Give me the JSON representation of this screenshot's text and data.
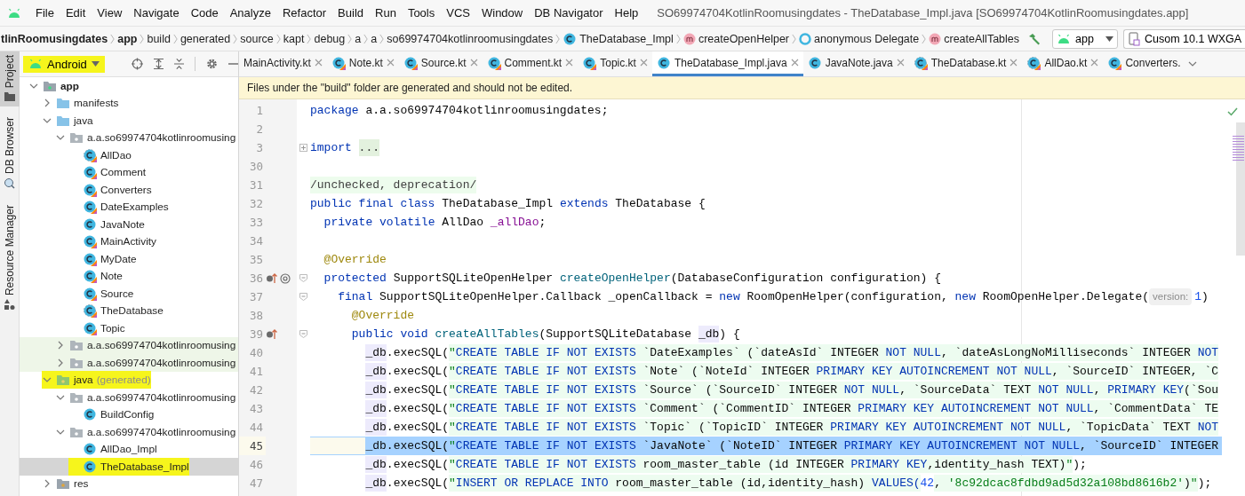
{
  "menu_bar": {
    "items": [
      "File",
      "Edit",
      "View",
      "Navigate",
      "Code",
      "Analyze",
      "Refactor",
      "Build",
      "Run",
      "Tools",
      "VCS",
      "Window",
      "DB Navigator",
      "Help"
    ],
    "title": "SO69974704KotlinRoomusingdates - TheDatabase_Impl.java [SO69974704KotlinRoomusingdates.app]"
  },
  "breadcrumbs": [
    {
      "label": "tlinRoomusingdates",
      "kind": "project"
    },
    {
      "label": "app",
      "kind": "module"
    },
    {
      "label": "build",
      "kind": "folder"
    },
    {
      "label": "generated",
      "kind": "folder"
    },
    {
      "label": "source",
      "kind": "folder"
    },
    {
      "label": "kapt",
      "kind": "folder"
    },
    {
      "label": "debug",
      "kind": "folder"
    },
    {
      "label": "a",
      "kind": "folder"
    },
    {
      "label": "a",
      "kind": "folder"
    },
    {
      "label": "so69974704kotlinroomusingdates",
      "kind": "folder"
    },
    {
      "label": "TheDatabase_Impl",
      "kind": "class"
    },
    {
      "label": "createOpenHelper",
      "kind": "method"
    },
    {
      "label": "anonymous Delegate",
      "kind": "anonymous"
    },
    {
      "label": "createAllTables",
      "kind": "method"
    }
  ],
  "toolbar": {
    "run_config": "app",
    "device": "Cusom 10.1  WXGA"
  },
  "tool_windows": [
    {
      "label": "Project",
      "kind": "project",
      "selected": true
    },
    {
      "label": "DB Browser",
      "kind": "db",
      "selected": false
    },
    {
      "label": "Resource Manager",
      "kind": "resources",
      "selected": false
    }
  ],
  "project_panel": {
    "view": "Android",
    "view_highlighted": true,
    "tree": [
      {
        "label": "app",
        "kind": "module",
        "expanded": true,
        "selected": false,
        "highlighted": false,
        "children": [
          {
            "label": "manifests",
            "kind": "folder",
            "expanded": false,
            "selected": false,
            "highlighted": false
          },
          {
            "label": "java",
            "kind": "folder",
            "expanded": true,
            "selected": false,
            "highlighted": false,
            "children": [
              {
                "label": "a.a.so69974704kotlinroomusing",
                "kind": "package",
                "expanded": true,
                "selected": false,
                "highlighted": false,
                "children": [
                  {
                    "label": "AllDao",
                    "kind": "kotlin-abstract",
                    "selected": false,
                    "highlighted": false
                  },
                  {
                    "label": "Comment",
                    "kind": "kotlin-class",
                    "selected": false,
                    "highlighted": false
                  },
                  {
                    "label": "Converters",
                    "kind": "kotlin-class",
                    "selected": false,
                    "highlighted": false
                  },
                  {
                    "label": "DateExamples",
                    "kind": "kotlin-class",
                    "selected": false,
                    "highlighted": false
                  },
                  {
                    "label": "JavaNote",
                    "kind": "java-class",
                    "selected": false,
                    "highlighted": false
                  },
                  {
                    "label": "MainActivity",
                    "kind": "kotlin-class",
                    "selected": false,
                    "highlighted": false
                  },
                  {
                    "label": "MyDate",
                    "kind": "kotlin-class",
                    "selected": false,
                    "highlighted": false
                  },
                  {
                    "label": "Note",
                    "kind": "kotlin-class",
                    "selected": false,
                    "highlighted": false
                  },
                  {
                    "label": "Source",
                    "kind": "kotlin-class",
                    "selected": false,
                    "highlighted": false
                  },
                  {
                    "label": "TheDatabase",
                    "kind": "kotlin-abstract",
                    "selected": false,
                    "highlighted": false
                  },
                  {
                    "label": "Topic",
                    "kind": "kotlin-class",
                    "selected": false,
                    "highlighted": false
                  }
                ]
              },
              {
                "label": "a.a.so69974704kotlinroomusing",
                "kind": "test-package",
                "expanded": false,
                "selected": false,
                "highlighted": false
              },
              {
                "label": "a.a.so69974704kotlinroomusing",
                "kind": "test-package",
                "expanded": false,
                "selected": false,
                "highlighted": false
              }
            ]
          },
          {
            "label": "java",
            "note": "(generated)",
            "kind": "generated-folder",
            "expanded": true,
            "selected": false,
            "highlighted": true,
            "children": [
              {
                "label": "a.a.so69974704kotlinroomusing",
                "kind": "package",
                "expanded": true,
                "selected": false,
                "highlighted": false,
                "children": [
                  {
                    "label": "BuildConfig",
                    "kind": "java-class",
                    "selected": false,
                    "highlighted": false
                  }
                ]
              },
              {
                "label": "a.a.so69974704kotlinroomusing",
                "kind": "package",
                "expanded": true,
                "selected": false,
                "highlighted": false,
                "children": [
                  {
                    "label": "AllDao_Impl",
                    "kind": "java-class",
                    "selected": false,
                    "highlighted": false
                  },
                  {
                    "label": "TheDatabase_Impl",
                    "kind": "java-class",
                    "selected": true,
                    "highlighted": true
                  }
                ]
              }
            ]
          },
          {
            "label": "res",
            "kind": "res-folder",
            "expanded": false,
            "selected": false,
            "highlighted": false
          }
        ]
      }
    ]
  },
  "editor_tabs": [
    {
      "label": "MainActivity.kt",
      "kind": "clipped",
      "selected": false,
      "closable": true
    },
    {
      "label": "Note.kt",
      "kind": "kotlin",
      "selected": false,
      "closable": true
    },
    {
      "label": "Source.kt",
      "kind": "kotlin",
      "selected": false,
      "closable": true
    },
    {
      "label": "Comment.kt",
      "kind": "kotlin",
      "selected": false,
      "closable": true
    },
    {
      "label": "Topic.kt",
      "kind": "kotlin",
      "selected": false,
      "closable": true
    },
    {
      "label": "TheDatabase_Impl.java",
      "kind": "java",
      "selected": true,
      "closable": true
    },
    {
      "label": "JavaNote.java",
      "kind": "java",
      "selected": false,
      "closable": true
    },
    {
      "label": "TheDatabase.kt",
      "kind": "kotlin-abstract",
      "selected": false,
      "closable": true
    },
    {
      "label": "AllDao.kt",
      "kind": "kotlin-abstract",
      "selected": false,
      "closable": true
    },
    {
      "label": "Converters.",
      "kind": "kotlin",
      "selected": false,
      "closable": false
    }
  ],
  "editor": {
    "banner": "Files under the \"build\" folder are generated and should not be edited.",
    "lines": [
      {
        "number": "1",
        "current": false,
        "selected": false,
        "segments": [
          {
            "text": "package",
            "kind": "kw"
          },
          {
            "text": " a.a.so69974704kotlinroomusingdates;",
            "kind": "plain"
          }
        ]
      },
      {
        "number": "2",
        "current": false,
        "selected": false
      },
      {
        "number": "3",
        "current": false,
        "selected": false,
        "fold": {
          "kind": "expand"
        },
        "segments": [
          {
            "text": "import ",
            "kind": "kw"
          },
          {
            "text": "...",
            "kind": "folded"
          }
        ]
      },
      {
        "number": "30",
        "current": false,
        "selected": false
      },
      {
        "number": "31",
        "current": false,
        "selected": false,
        "segments": [
          {
            "text": "/unchecked, deprecation/",
            "kind": "comment"
          }
        ]
      },
      {
        "number": "32",
        "current": false,
        "selected": false,
        "segments": [
          {
            "text": "public final class",
            "kind": "kw"
          },
          {
            "text": " TheDatabase_Impl ",
            "kind": "plain"
          },
          {
            "text": "extends",
            "kind": "kw"
          },
          {
            "text": " TheDatabase {",
            "kind": "plain"
          }
        ]
      },
      {
        "number": "33",
        "current": false,
        "selected": false,
        "segments": [
          {
            "text": "  private volatile",
            "kind": "kw"
          },
          {
            "text": " AllDao ",
            "kind": "plain"
          },
          {
            "text": "_allDao",
            "kind": "field"
          },
          {
            "text": ";",
            "kind": "plain"
          }
        ]
      },
      {
        "number": "34",
        "current": false,
        "selected": false
      },
      {
        "number": "35",
        "current": false,
        "selected": false,
        "segments": [
          {
            "text": "  @Override",
            "kind": "ann"
          }
        ]
      },
      {
        "number": "36",
        "current": false,
        "selected": false,
        "gutter_icons": [
          {
            "kind": "override"
          },
          {
            "kind": "annotation"
          }
        ],
        "fold": {
          "kind": "collapse"
        },
        "segments": [
          {
            "text": "  protected",
            "kind": "kw"
          },
          {
            "text": " SupportSQLiteOpenHelper ",
            "kind": "plain"
          },
          {
            "text": "createOpenHelper",
            "kind": "method"
          },
          {
            "text": "(DatabaseConfiguration configuration) {",
            "kind": "plain"
          }
        ]
      },
      {
        "number": "37",
        "current": false,
        "selected": false,
        "fold": {
          "kind": "collapse"
        },
        "segments": [
          {
            "text": "    final",
            "kind": "kw"
          },
          {
            "text": " SupportSQLiteOpenHelper.Callback _openCallback = ",
            "kind": "plain"
          },
          {
            "text": "new",
            "kind": "kw"
          },
          {
            "text": " RoomOpenHelper(configuration, ",
            "kind": "plain"
          },
          {
            "text": "new",
            "kind": "kw"
          },
          {
            "text": " RoomOpenHelper.Delegate(",
            "kind": "plain"
          },
          {
            "text": "version:",
            "kind": "hint"
          },
          {
            "text": "1",
            "kind": "num"
          },
          {
            "text": ")",
            "kind": "plain"
          }
        ]
      },
      {
        "number": "38",
        "current": false,
        "selected": false,
        "segments": [
          {
            "text": "      @Override",
            "kind": "ann"
          }
        ]
      },
      {
        "number": "39",
        "current": false,
        "selected": false,
        "gutter_icons": [
          {
            "kind": "override"
          }
        ],
        "fold": {
          "kind": "collapse"
        },
        "segments": [
          {
            "text": "      public void",
            "kind": "kw"
          },
          {
            "text": " createAllTables",
            "kind": "method"
          },
          {
            "text": "(SupportSQLiteDatabase ",
            "kind": "plain"
          },
          {
            "text": "_db",
            "kind": "param"
          },
          {
            "text": ") {",
            "kind": "plain"
          }
        ]
      },
      {
        "number": "40",
        "current": false,
        "selected": false,
        "segments": [
          {
            "text": "        _db",
            "kind": "param"
          },
          {
            "text": ".execSQL(",
            "kind": "plain"
          },
          {
            "text": "\"",
            "kind": "str"
          },
          {
            "text": "CREATE TABLE IF NOT EXISTS",
            "kind": "sqlkw"
          },
          {
            "text": " `DateExamples` (`dateAsId` INTEGER ",
            "kind": "sqlid"
          },
          {
            "text": "NOT NULL",
            "kind": "sqlkw"
          },
          {
            "text": ", `dateAsLongNoMilliseconds` INTEGER ",
            "kind": "sqlid"
          },
          {
            "text": "NOT",
            "kind": "sqlkw"
          }
        ]
      },
      {
        "number": "41",
        "current": false,
        "selected": false,
        "segments": [
          {
            "text": "        _db",
            "kind": "param"
          },
          {
            "text": ".execSQL(",
            "kind": "plain"
          },
          {
            "text": "\"",
            "kind": "str"
          },
          {
            "text": "CREATE TABLE IF NOT EXISTS",
            "kind": "sqlkw"
          },
          {
            "text": " `Note` (`NoteId` INTEGER ",
            "kind": "sqlid"
          },
          {
            "text": "PRIMARY KEY AUTOINCREMENT NOT NULL",
            "kind": "sqlkw"
          },
          {
            "text": ", `SourceID` INTEGER, `C",
            "kind": "sqlid"
          }
        ]
      },
      {
        "number": "42",
        "current": false,
        "selected": false,
        "segments": [
          {
            "text": "        _db",
            "kind": "param"
          },
          {
            "text": ".execSQL(",
            "kind": "plain"
          },
          {
            "text": "\"",
            "kind": "str"
          },
          {
            "text": "CREATE TABLE IF NOT EXISTS",
            "kind": "sqlkw"
          },
          {
            "text": " `Source` (`SourceID` INTEGER ",
            "kind": "sqlid"
          },
          {
            "text": "NOT NULL",
            "kind": "sqlkw"
          },
          {
            "text": ", `SourceData` TEXT ",
            "kind": "sqlid"
          },
          {
            "text": "NOT NULL",
            "kind": "sqlkw"
          },
          {
            "text": ", ",
            "kind": "sqlid"
          },
          {
            "text": "PRIMARY KEY",
            "kind": "sqlkw"
          },
          {
            "text": "(`Sou",
            "kind": "sqlid"
          }
        ]
      },
      {
        "number": "43",
        "current": false,
        "selected": false,
        "segments": [
          {
            "text": "        _db",
            "kind": "param"
          },
          {
            "text": ".execSQL(",
            "kind": "plain"
          },
          {
            "text": "\"",
            "kind": "str"
          },
          {
            "text": "CREATE TABLE IF NOT EXISTS",
            "kind": "sqlkw"
          },
          {
            "text": " `Comment` (`CommentID` INTEGER ",
            "kind": "sqlid"
          },
          {
            "text": "PRIMARY KEY AUTOINCREMENT NOT NULL",
            "kind": "sqlkw"
          },
          {
            "text": ", `CommentData` TE",
            "kind": "sqlid"
          }
        ]
      },
      {
        "number": "44",
        "current": false,
        "selected": false,
        "segments": [
          {
            "text": "        _db",
            "kind": "param"
          },
          {
            "text": ".execSQL(",
            "kind": "plain"
          },
          {
            "text": "\"",
            "kind": "str"
          },
          {
            "text": "CREATE TABLE IF NOT EXISTS",
            "kind": "sqlkw"
          },
          {
            "text": " `Topic` (`TopicID` INTEGER ",
            "kind": "sqlid"
          },
          {
            "text": "PRIMARY KEY AUTOINCREMENT NOT NULL",
            "kind": "sqlkw"
          },
          {
            "text": ", `TopicData` TEXT ",
            "kind": "sqlid"
          },
          {
            "text": "NOT",
            "kind": "sqlkw"
          }
        ]
      },
      {
        "number": "45",
        "current": true,
        "selected": true,
        "segments": [
          {
            "text": "        _db",
            "kind": "param"
          },
          {
            "text": ".execSQL(",
            "kind": "plain"
          },
          {
            "text": "\"",
            "kind": "str"
          },
          {
            "text": "CREATE TABLE IF NOT EXISTS",
            "kind": "sqlkw"
          },
          {
            "text": " `JavaNote` (`NoteID` INTEGER ",
            "kind": "sqlid"
          },
          {
            "text": "PRIMARY KEY AUTOINCREMENT NOT NULL",
            "kind": "sqlkw"
          },
          {
            "text": ", `SourceID` INTEGER",
            "kind": "sqlid"
          }
        ]
      },
      {
        "number": "46",
        "current": false,
        "selected": false,
        "segments": [
          {
            "text": "        _db",
            "kind": "param"
          },
          {
            "text": ".execSQL(",
            "kind": "plain"
          },
          {
            "text": "\"",
            "kind": "str"
          },
          {
            "text": "CREATE TABLE IF NOT EXISTS",
            "kind": "sqlkw"
          },
          {
            "text": " room_master_table (id INTEGER ",
            "kind": "sqlid"
          },
          {
            "text": "PRIMARY KEY",
            "kind": "sqlkw"
          },
          {
            "text": ",identity_hash TEXT)",
            "kind": "sqlid"
          },
          {
            "text": "\"",
            "kind": "str"
          },
          {
            "text": ");",
            "kind": "plain"
          }
        ]
      },
      {
        "number": "47",
        "current": false,
        "selected": false,
        "segments": [
          {
            "text": "        _db",
            "kind": "param"
          },
          {
            "text": ".execSQL(",
            "kind": "plain"
          },
          {
            "text": "\"",
            "kind": "str"
          },
          {
            "text": "INSERT OR REPLACE INTO",
            "kind": "sqlkw"
          },
          {
            "text": " room_master_table (id,identity_hash) ",
            "kind": "sqlid"
          },
          {
            "text": "VALUES(",
            "kind": "sqlkw"
          },
          {
            "text": "42",
            "kind": "num"
          },
          {
            "text": ", ",
            "kind": "sqlid"
          },
          {
            "text": "'8c92dcac8fdbd9ad5d32a108bd8616b2'",
            "kind": "str"
          },
          {
            "text": ")",
            "kind": "sqlid"
          },
          {
            "text": "\"",
            "kind": "str"
          },
          {
            "text": ");",
            "kind": "plain"
          }
        ]
      }
    ]
  }
}
